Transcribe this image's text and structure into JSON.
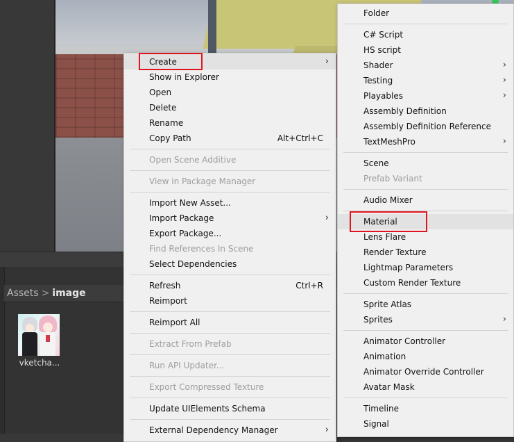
{
  "breadcrumb": {
    "root": "Assets",
    "separator": ">",
    "current": "image"
  },
  "asset": {
    "label": "vketcha..."
  },
  "context_menu": {
    "items": [
      {
        "label": "Create",
        "submenu": true,
        "highlighted": true
      },
      {
        "label": "Show in Explorer"
      },
      {
        "label": "Open"
      },
      {
        "label": "Delete"
      },
      {
        "label": "Rename"
      },
      {
        "label": "Copy Path",
        "shortcut": "Alt+Ctrl+C"
      },
      {
        "separator": true
      },
      {
        "label": "Open Scene Additive",
        "disabled": true
      },
      {
        "separator": true
      },
      {
        "label": "View in Package Manager",
        "disabled": true
      },
      {
        "separator": true
      },
      {
        "label": "Import New Asset..."
      },
      {
        "label": "Import Package",
        "submenu": true
      },
      {
        "label": "Export Package..."
      },
      {
        "label": "Find References In Scene",
        "disabled": true
      },
      {
        "label": "Select Dependencies"
      },
      {
        "separator": true
      },
      {
        "label": "Refresh",
        "shortcut": "Ctrl+R"
      },
      {
        "label": "Reimport"
      },
      {
        "separator": true
      },
      {
        "label": "Reimport All"
      },
      {
        "separator": true
      },
      {
        "label": "Extract From Prefab",
        "disabled": true
      },
      {
        "separator": true
      },
      {
        "label": "Run API Updater...",
        "disabled": true
      },
      {
        "separator": true
      },
      {
        "label": "Export Compressed Texture",
        "disabled": true
      },
      {
        "separator": true
      },
      {
        "label": "Update UIElements Schema"
      },
      {
        "separator": true
      },
      {
        "label": "External Dependency Manager",
        "submenu": true
      }
    ]
  },
  "create_submenu": {
    "items": [
      {
        "label": "Folder"
      },
      {
        "separator": true
      },
      {
        "label": "C# Script"
      },
      {
        "label": "HS script"
      },
      {
        "label": "Shader",
        "submenu": true
      },
      {
        "label": "Testing",
        "submenu": true
      },
      {
        "label": "Playables",
        "submenu": true
      },
      {
        "label": "Assembly Definition"
      },
      {
        "label": "Assembly Definition Reference"
      },
      {
        "label": "TextMeshPro",
        "submenu": true
      },
      {
        "separator": true
      },
      {
        "label": "Scene"
      },
      {
        "label": "Prefab Variant",
        "disabled": true
      },
      {
        "separator": true
      },
      {
        "label": "Audio Mixer"
      },
      {
        "separator": true
      },
      {
        "label": "Material",
        "highlighted": true
      },
      {
        "label": "Lens Flare"
      },
      {
        "label": "Render Texture"
      },
      {
        "label": "Lightmap Parameters"
      },
      {
        "label": "Custom Render Texture"
      },
      {
        "separator": true
      },
      {
        "label": "Sprite Atlas"
      },
      {
        "label": "Sprites",
        "submenu": true
      },
      {
        "separator": true
      },
      {
        "label": "Animator Controller"
      },
      {
        "label": "Animation"
      },
      {
        "label": "Animator Override Controller"
      },
      {
        "label": "Avatar Mask"
      },
      {
        "separator": true
      },
      {
        "label": "Timeline"
      },
      {
        "label": "Signal"
      }
    ]
  },
  "colors": {
    "annotation_red": "#e0161e",
    "menu_bg": "#f0f0f0",
    "disabled_text": "#9d9d9d"
  }
}
